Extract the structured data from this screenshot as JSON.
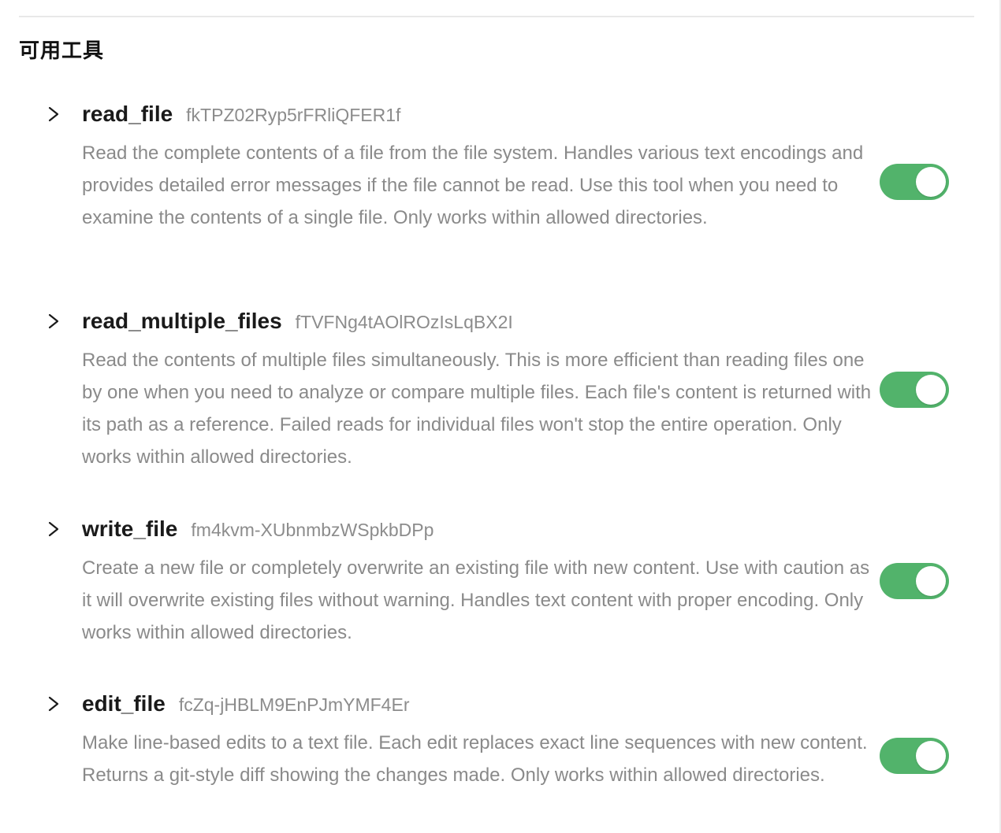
{
  "section": {
    "title": "可用工具"
  },
  "tools": [
    {
      "name": "read_file",
      "id": "fkTPZ02Ryp5rFRliQFER1f",
      "description": "Read the complete contents of a file from the file system. Handles various text encodings and provides detailed error messages if the file cannot be read. Use this tool when you need to examine the contents of a single file. Only works within allowed directories.",
      "enabled": true
    },
    {
      "name": "read_multiple_files",
      "id": "fTVFNg4tAOlROzIsLqBX2I",
      "description": "Read the contents of multiple files simultaneously. This is more efficient than reading files one by one when you need to analyze or compare multiple files. Each file's content is returned with its path as a reference. Failed reads for individual files won't stop the entire operation. Only works within allowed directories.",
      "enabled": true
    },
    {
      "name": "write_file",
      "id": "fm4kvm-XUbnmbzWSpkbDPp",
      "description": "Create a new file or completely overwrite an existing file with new content. Use with caution as it will overwrite existing files without warning. Handles text content with proper encoding. Only works within allowed directories.",
      "enabled": true
    },
    {
      "name": "edit_file",
      "id": "fcZq-jHBLM9EnPJmYMF4Er",
      "description": "Make line-based edits to a text file. Each edit replaces exact line sequences with new content. Returns a git-style diff showing the changes made. Only works within allowed directories.",
      "enabled": true
    }
  ],
  "icons": {
    "expand": "chevron-right-icon"
  },
  "colors": {
    "toggle_on": "#52b36b",
    "description_text": "#8a8a8a",
    "id_text": "#8c8c8c"
  }
}
